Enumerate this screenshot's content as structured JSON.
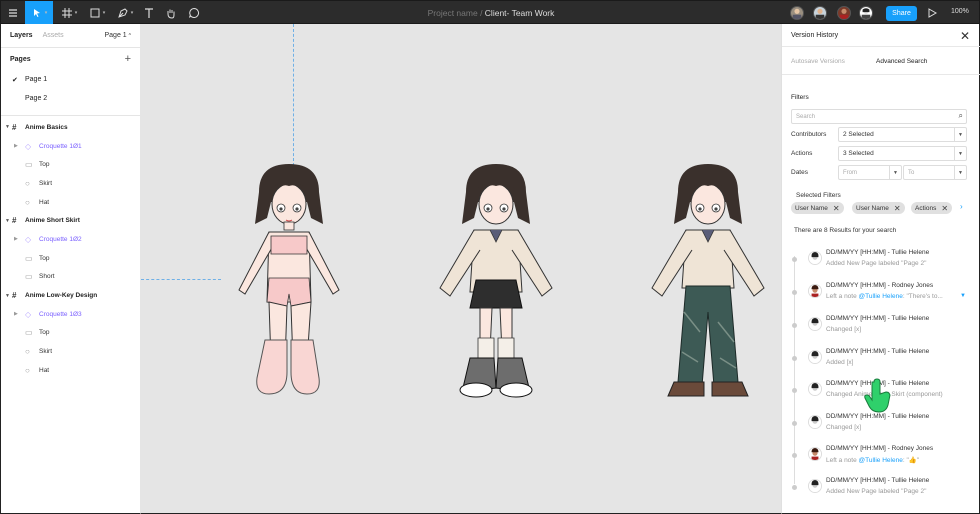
{
  "toolbar": {
    "project_name": "Project name",
    "separator": " / ",
    "file_name": "Client- Team Work",
    "share_label": "Share",
    "zoom": "100%",
    "tools": [
      "menu-icon",
      "move-icon",
      "frame-icon",
      "shape-icon",
      "pen-icon",
      "text-icon",
      "hand-icon",
      "comment-icon"
    ],
    "accent": "#18a0fb"
  },
  "left_panel": {
    "tab_layers": "Layers",
    "tab_assets": "Assets",
    "page_selector": "Page 1",
    "pages_header": "Pages",
    "pages": [
      "Page 1",
      "Page 2"
    ],
    "frames": [
      {
        "name": "Anime Basics",
        "component": "Croquette 1Ø1",
        "children": [
          "Top",
          "Skirt",
          "Hat"
        ]
      },
      {
        "name": "Anime Short Skirt",
        "component": "Croquette 1Ø2",
        "children": [
          "Top",
          "Short"
        ]
      },
      {
        "name": "Anime Low-Key Design",
        "component": "Croquette 1Ø3",
        "children": [
          "Top",
          "Skirt",
          "Hat"
        ]
      }
    ]
  },
  "right_panel": {
    "title": "Version History",
    "tab_autosave": "Autosave Versions",
    "tab_advanced": "Advanced Search",
    "filters_header": "Filters",
    "search_placeholder": "Search",
    "contributors_label": "Contributors",
    "contributors_value": "2 Selected",
    "actions_label": "Actions",
    "actions_value": "3 Selected",
    "dates_label": "Dates",
    "date_from": "From",
    "date_to": "To",
    "selected_filters_label": "Selected Filters",
    "chips": [
      "User Name",
      "User Name",
      "Actions"
    ],
    "results_text": "There are 8 Results for your search",
    "entries": [
      {
        "head": "DD/MM/YY [HH:MM] - Tullie Helene",
        "desc": "Added New Page labeled \"Page 2\""
      },
      {
        "head": "DD/MM/YY [HH:MM] - Rodney Jones",
        "desc_pre": "Left a note ",
        "mention": "@Tullie Helene",
        "desc_post": ": \"There's to..."
      },
      {
        "head": "DD/MM/YY [HH:MM] - Tullie Helene",
        "desc": "Changed [x]"
      },
      {
        "head": "DD/MM/YY [HH:MM] - Tullie Helene",
        "desc": "Added [x]"
      },
      {
        "head": "DD/MM/YY [HH:MM] - Tullie Helene",
        "desc": "Changed Anime Short Skirt (component)"
      },
      {
        "head": "DD/MM/YY [HH:MM] - Tullie Helene",
        "desc": "Changed [x]"
      },
      {
        "head": "DD/MM/YY [HH:MM] - Rodney Jones",
        "desc_pre": "Left a note ",
        "mention": "@Tullie Helene",
        "desc_post": ": \"👍\""
      },
      {
        "head": "DD/MM/YY [HH:MM] - Tullie Helene",
        "desc": "Added New Page labeled \"Page 2\""
      }
    ]
  }
}
